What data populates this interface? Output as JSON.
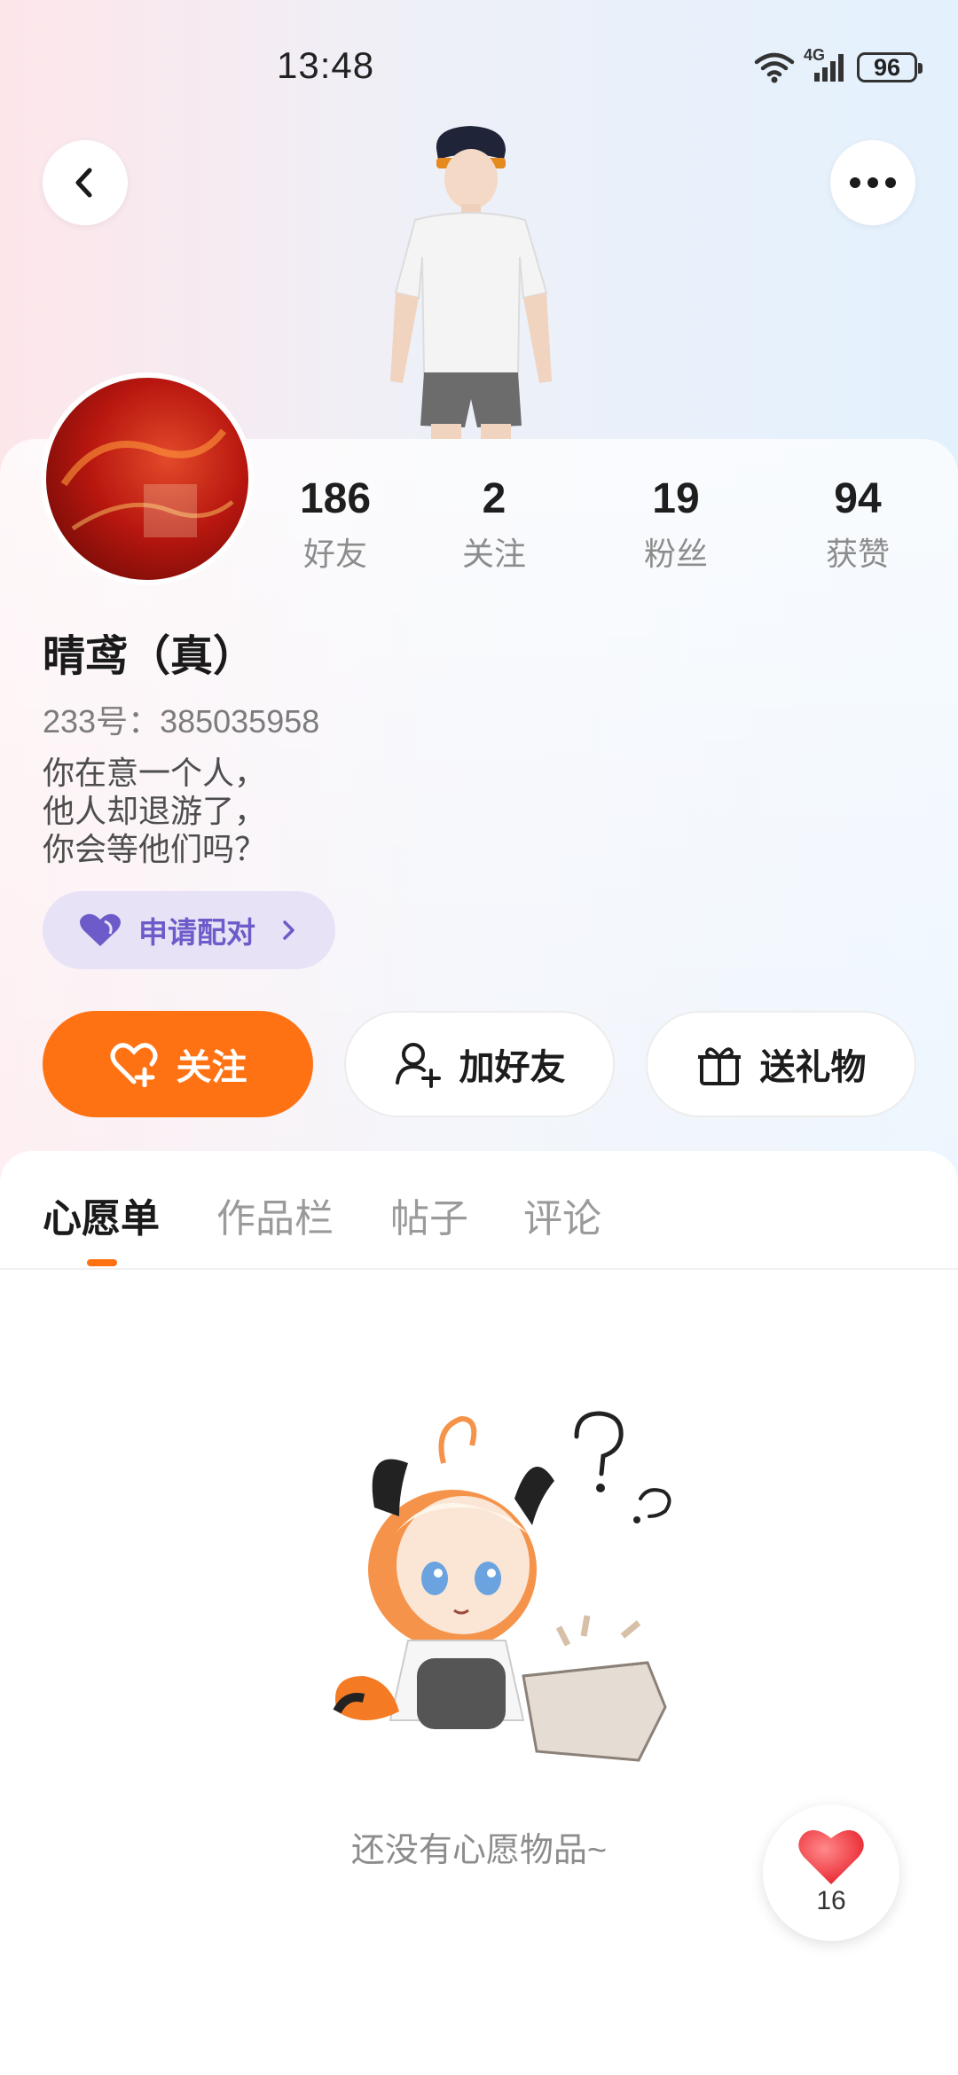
{
  "status_bar": {
    "time": "13:48",
    "network": "4G",
    "battery": "96"
  },
  "profile": {
    "name": "晴鸢（真）",
    "uid": "233号：385035958",
    "bio_lines": [
      "你在意一个人，",
      "他人却退游了，",
      "你会等他们吗？"
    ]
  },
  "stats": [
    {
      "value": "186",
      "label": "好友"
    },
    {
      "value": "2",
      "label": "关注"
    },
    {
      "value": "19",
      "label": "粉丝"
    },
    {
      "value": "94",
      "label": "获赞"
    }
  ],
  "pair_button": {
    "label": "申请配对"
  },
  "actions": {
    "follow": "关注",
    "add_friend": "加好友",
    "send_gift": "送礼物"
  },
  "tabs": [
    {
      "label": "心愿单",
      "active": true
    },
    {
      "label": "作品栏",
      "active": false
    },
    {
      "label": "帖子",
      "active": false
    },
    {
      "label": "评论",
      "active": false
    }
  ],
  "empty_state": {
    "message": "还没有心愿物品~"
  },
  "like_button": {
    "count": "16"
  },
  "colors": {
    "accent": "#ff7214",
    "pair_purple": "#6d5bc9",
    "pair_bg": "#e7e2f6"
  },
  "icons": [
    "back-arrow-icon",
    "more-dots-icon",
    "wifi-icon",
    "signal-icon",
    "battery-icon",
    "heart-icon",
    "add-user-icon",
    "gift-icon",
    "chevron-right-icon",
    "heart-plus-icon"
  ]
}
